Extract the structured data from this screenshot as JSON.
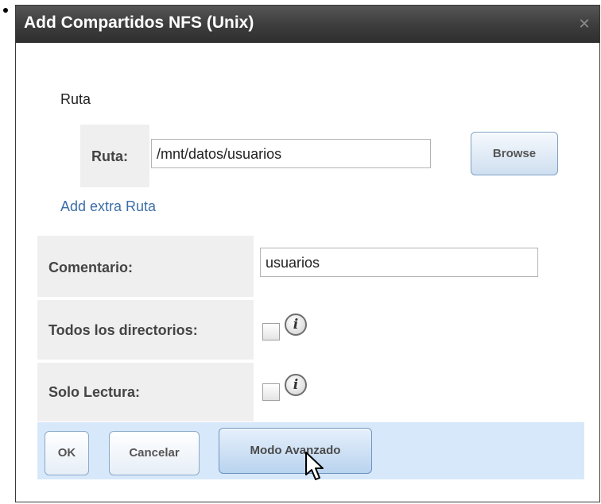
{
  "dialog": {
    "title": "Add Compartidos NFS (Unix)",
    "close_icon": "close-icon"
  },
  "path_section": {
    "heading": "Ruta",
    "path_label": "Ruta:",
    "path_value": "/mnt/datos/usuarios",
    "browse_label": "Browse",
    "add_extra_link": "Add extra Ruta"
  },
  "form": {
    "comment_label": "Comentario:",
    "comment_value": "usuarios",
    "all_dirs_label": "Todos los directorios:",
    "all_dirs_checked": false,
    "read_only_label": "Solo Lectura:",
    "read_only_checked": false,
    "info_glyph": "i"
  },
  "buttons": {
    "ok": "OK",
    "cancel": "Cancelar",
    "advanced": "Modo Avanzado"
  },
  "colors": {
    "title_bar": "#3c3c3c",
    "link": "#3b6ea8",
    "button_bar": "#d7e8fa",
    "label_cell": "#efefef"
  }
}
